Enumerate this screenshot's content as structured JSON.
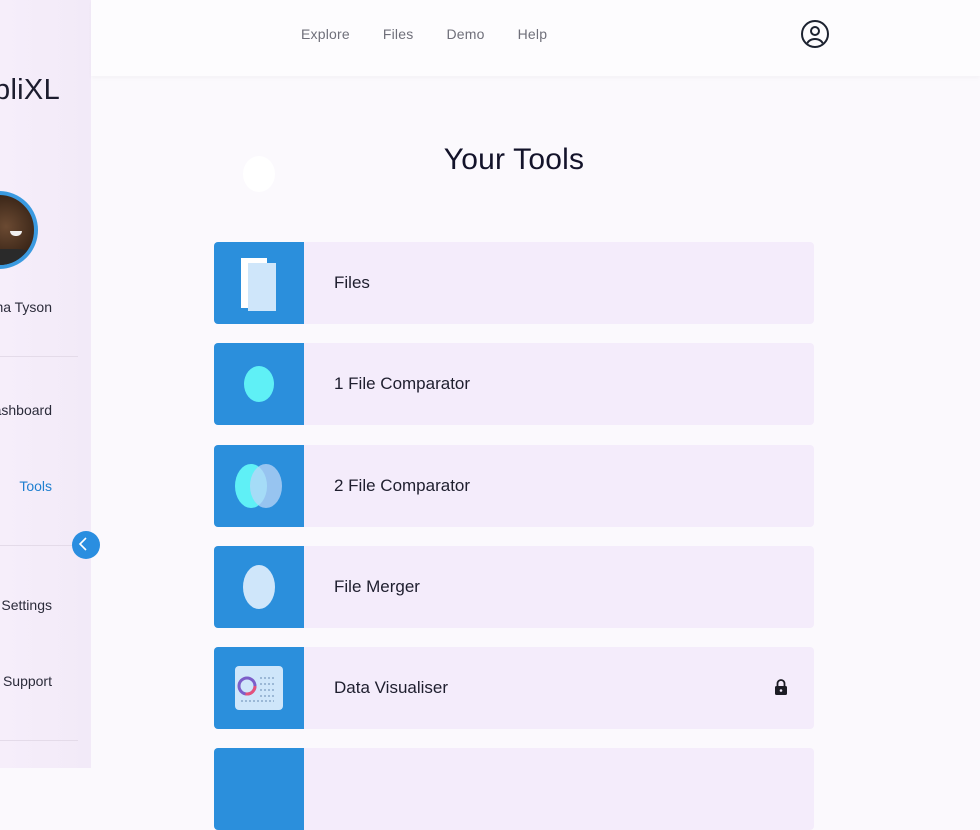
{
  "sidebar": {
    "brand": "SimpliXL",
    "user_name": "Amma Tyson",
    "nav": [
      {
        "label": "Dashboard",
        "active": false
      },
      {
        "label": "Tools",
        "active": true
      },
      {
        "label": "Settings",
        "active": false
      },
      {
        "label": "Support",
        "active": false
      }
    ],
    "collapse_icon": "chevron-left-icon",
    "accent": "#2b8fdc"
  },
  "topnav": {
    "items": [
      "Explore",
      "Files",
      "Demo",
      "Help"
    ],
    "profile_icon": "user-icon"
  },
  "main": {
    "title": "Your Tools",
    "tools": [
      {
        "label": "Files",
        "icon": "files-icon",
        "locked": false
      },
      {
        "label": "1 File Comparator",
        "icon": "single-circle-icon",
        "locked": false
      },
      {
        "label": "2 File Comparator",
        "icon": "overlap-circles-icon",
        "locked": false
      },
      {
        "label": "File Merger",
        "icon": "merge-circle-icon",
        "locked": false
      },
      {
        "label": "Data Visualiser",
        "icon": "dashboard-chart-icon",
        "locked": true
      }
    ]
  }
}
